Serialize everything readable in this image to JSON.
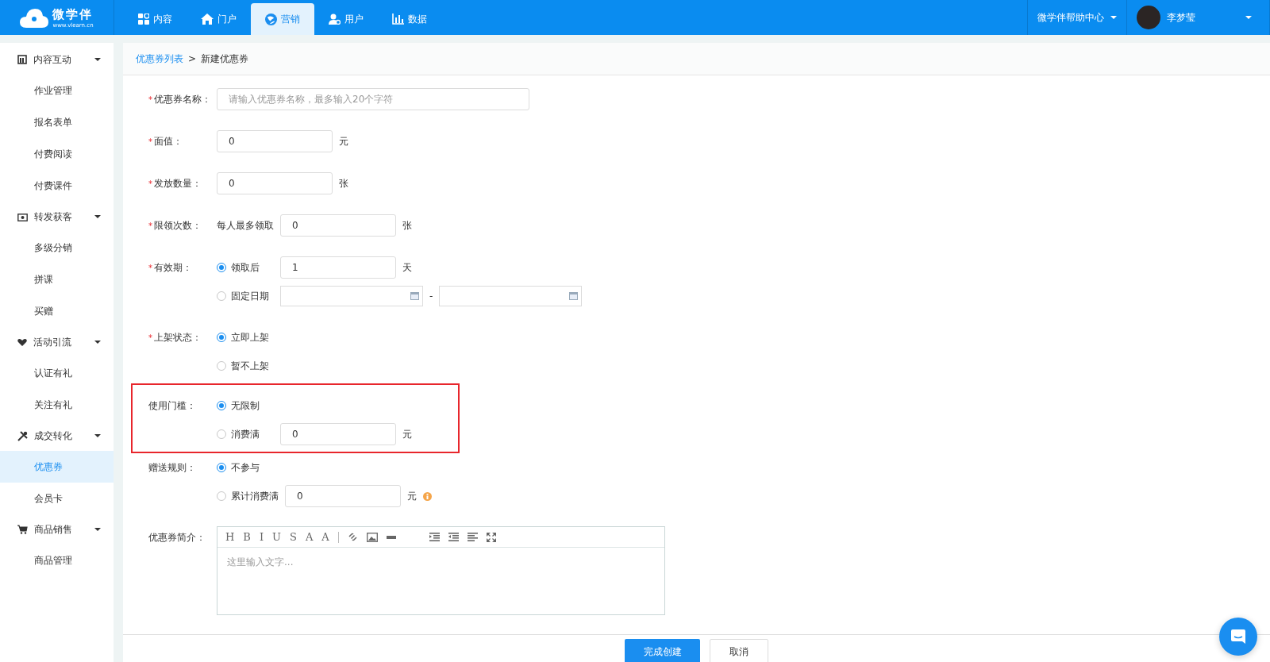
{
  "header": {
    "logo": {
      "name": "微学伴",
      "url": "www.vlearn.cn"
    },
    "nav": [
      {
        "label": "内容",
        "selected": false
      },
      {
        "label": "门户",
        "selected": false
      },
      {
        "label": "营销",
        "selected": true
      },
      {
        "label": "用户",
        "selected": false
      },
      {
        "label": "数据",
        "selected": false
      }
    ],
    "help": "微学伴帮助中心",
    "user": "李梦莹"
  },
  "sidebar": [
    {
      "label": "内容互动",
      "expanded": true,
      "children": [
        {
          "label": "作业管理",
          "selected": false
        },
        {
          "label": "报名表单",
          "selected": false
        },
        {
          "label": "付费阅读",
          "selected": false
        },
        {
          "label": "付费课件",
          "selected": false
        }
      ]
    },
    {
      "label": "转发获客",
      "expanded": true,
      "children": [
        {
          "label": "多级分销",
          "selected": false
        },
        {
          "label": "拼课",
          "selected": false
        },
        {
          "label": "买赠",
          "selected": false
        }
      ]
    },
    {
      "label": "活动引流",
      "expanded": true,
      "children": [
        {
          "label": "认证有礼",
          "selected": false
        },
        {
          "label": "关注有礼",
          "selected": false
        }
      ]
    },
    {
      "label": "成交转化",
      "expanded": true,
      "children": [
        {
          "label": "优惠券",
          "selected": true
        },
        {
          "label": "会员卡",
          "selected": false
        }
      ]
    },
    {
      "label": "商品销售",
      "expanded": true,
      "children": [
        {
          "label": "商品管理",
          "selected": false
        }
      ]
    }
  ],
  "breadcrumb": {
    "link": "优惠券列表",
    "separator": ">",
    "current": "新建优惠券"
  },
  "form": [
    {
      "kind": "input",
      "label": "优惠券名称：",
      "required_mark": "*",
      "highlighted": false,
      "placeholder": "请输入优惠券名称，最多输入20个字符"
    },
    {
      "kind": "number",
      "label": "面值：",
      "required_mark": "*",
      "highlighted": false,
      "value": "0",
      "unit": "元"
    },
    {
      "kind": "number",
      "label": "发放数量：",
      "required_mark": "*",
      "highlighted": false,
      "value": "0",
      "unit": "张"
    },
    {
      "kind": "number",
      "label": "限领次数：",
      "required_mark": "*",
      "highlighted": false,
      "prefix": "每人最多领取",
      "value": "0",
      "unit": "张"
    },
    {
      "kind": "radios",
      "label": "有效期：",
      "required_mark": "*",
      "highlighted": false,
      "options": [
        {
          "kind": "input",
          "label": "领取后",
          "selected": true,
          "value": "1",
          "unit": "天"
        },
        {
          "kind": "dates",
          "label": "固定日期",
          "selected": false,
          "separator": "-"
        }
      ]
    },
    {
      "kind": "radios",
      "label": "上架状态：",
      "required_mark": "*",
      "highlighted": false,
      "options": [
        {
          "kind": "plain",
          "label": "立即上架",
          "selected": true
        },
        {
          "kind": "plain",
          "label": "暂不上架",
          "selected": false
        }
      ]
    },
    {
      "kind": "radios",
      "label": "使用门槛：",
      "highlighted": true,
      "options": [
        {
          "kind": "plain",
          "label": "无限制",
          "selected": true
        },
        {
          "kind": "input",
          "label": "消费满",
          "selected": false,
          "value": "0",
          "unit": "元"
        }
      ]
    },
    {
      "kind": "radios",
      "label": "赠送规则：",
      "highlighted": false,
      "options": [
        {
          "kind": "plain",
          "label": "不参与",
          "selected": true
        },
        {
          "kind": "input",
          "label": "累计消费满",
          "selected": false,
          "value": "0",
          "unit": "元",
          "info": true
        }
      ]
    },
    {
      "kind": "editor",
      "label": "优惠券简介：",
      "highlighted": false,
      "placeholder": "这里输入文字...",
      "toolbar": [
        {
          "kind": "glyph",
          "label": "H"
        },
        {
          "kind": "glyph",
          "label": "B"
        },
        {
          "kind": "glyph",
          "label": "I"
        },
        {
          "kind": "glyph",
          "label": "U"
        },
        {
          "kind": "glyph",
          "label": "S"
        },
        {
          "kind": "glyph",
          "label": "A"
        },
        {
          "kind": "glyph",
          "label": "A"
        },
        {
          "kind": "divider"
        },
        {
          "kind": "link"
        },
        {
          "kind": "image"
        },
        {
          "kind": "rule"
        },
        {
          "kind": "space"
        },
        {
          "kind": "indent"
        },
        {
          "kind": "outdent"
        },
        {
          "kind": "align"
        },
        {
          "kind": "fullscreen"
        }
      ]
    }
  ],
  "footer": [
    {
      "label": "完成创建",
      "kind": "primary"
    },
    {
      "label": "取消",
      "kind": "default"
    }
  ]
}
